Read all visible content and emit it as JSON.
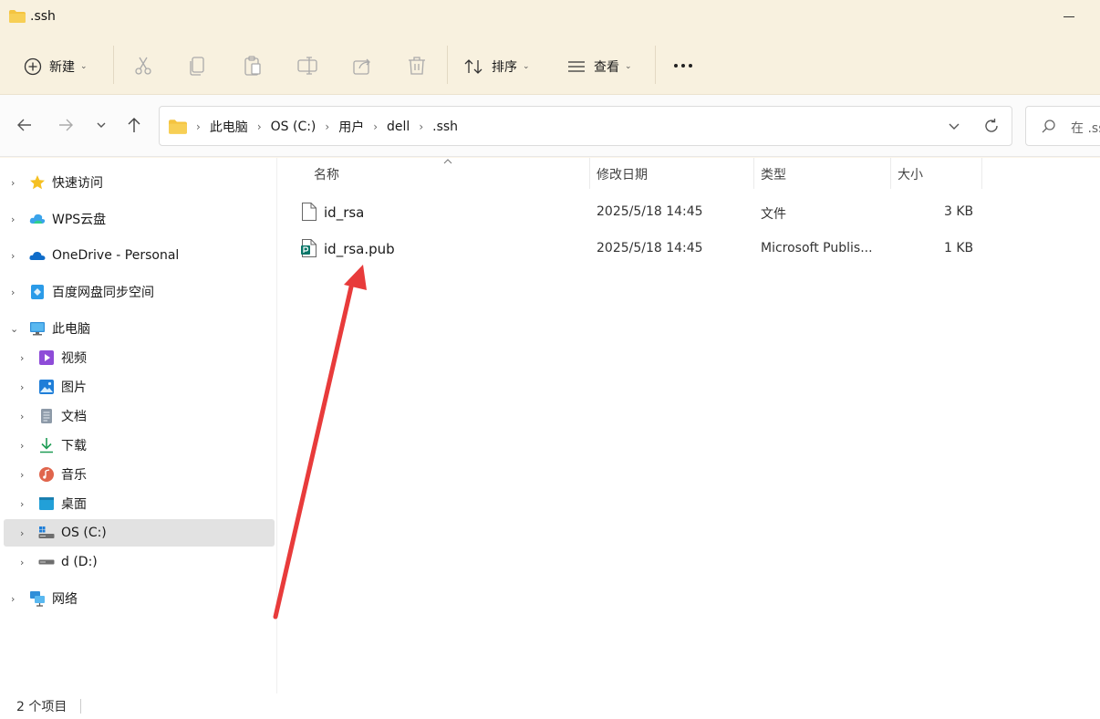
{
  "window": {
    "title": ".ssh"
  },
  "toolbar": {
    "new_label": "新建",
    "sort_label": "排序",
    "view_label": "查看"
  },
  "address": {
    "crumbs": [
      "此电脑",
      "OS (C:)",
      "用户",
      "dell",
      ".ssh"
    ],
    "search_placeholder": "在 .ss"
  },
  "sidebar": {
    "items": [
      {
        "label": "快速访问",
        "icon": "star-icon"
      },
      {
        "label": "WPS云盘",
        "icon": "cloud-icon"
      },
      {
        "label": "OneDrive - Personal",
        "icon": "onedrive-icon"
      },
      {
        "label": "百度网盘同步空间",
        "icon": "baidu-netdisk-icon"
      },
      {
        "label": "此电脑",
        "icon": "computer-icon"
      },
      {
        "label": "视频",
        "icon": "video-icon"
      },
      {
        "label": "图片",
        "icon": "picture-icon"
      },
      {
        "label": "文档",
        "icon": "document-icon"
      },
      {
        "label": "下载",
        "icon": "download-icon"
      },
      {
        "label": "音乐",
        "icon": "music-icon"
      },
      {
        "label": "桌面",
        "icon": "desktop-icon"
      },
      {
        "label": "OS (C:)",
        "icon": "drive-c-icon"
      },
      {
        "label": "d (D:)",
        "icon": "drive-d-icon"
      },
      {
        "label": "网络",
        "icon": "network-icon"
      }
    ]
  },
  "columns": {
    "name": "名称",
    "modified": "修改日期",
    "type": "类型",
    "size": "大小"
  },
  "files": [
    {
      "name": "id_rsa",
      "modified": "2025/5/18 14:45",
      "type": "文件",
      "size": "3 KB",
      "icon": "file-icon"
    },
    {
      "name": "id_rsa.pub",
      "modified": "2025/5/18 14:45",
      "type": "Microsoft Publis...",
      "size": "1 KB",
      "icon": "publisher-file-icon"
    }
  ],
  "status": {
    "item_count": "2 个项目"
  },
  "colors": {
    "accent": "#0067c0",
    "folder": "#f4c440",
    "annotation_arrow": "#e83b3b",
    "selected": "#e2e2e2"
  }
}
